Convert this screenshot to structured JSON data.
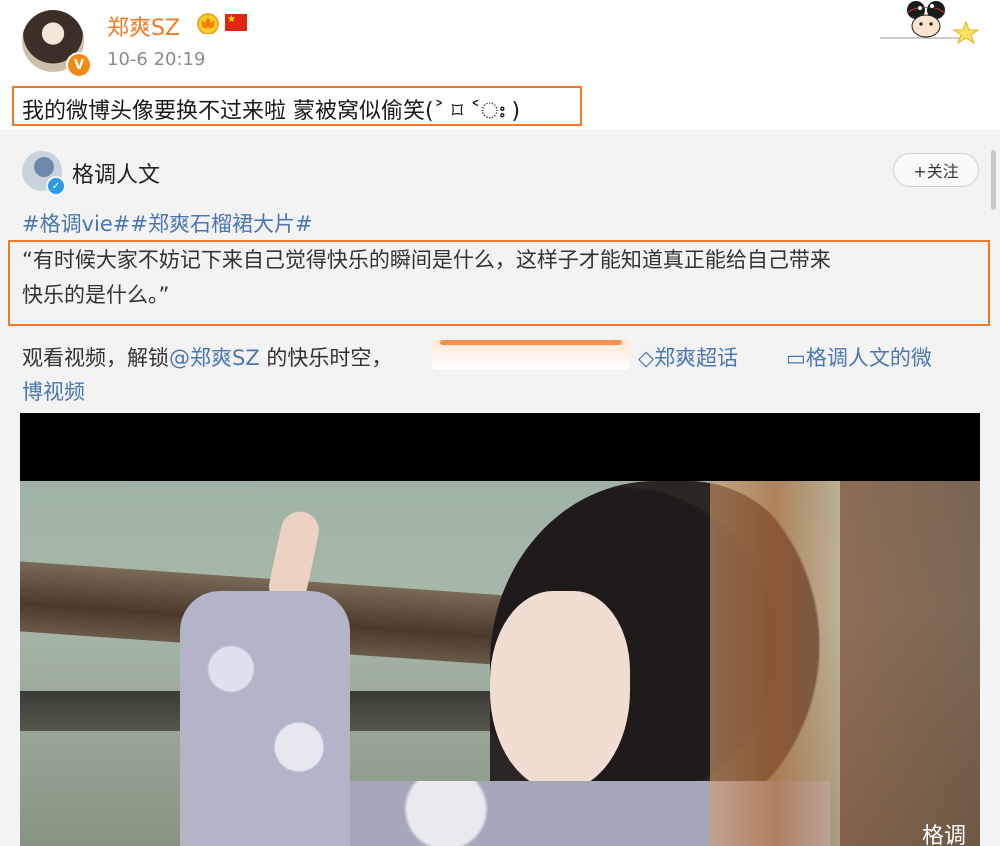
{
  "post": {
    "username": "郑爽SZ",
    "timestamp": "10-6 20:19",
    "text": "我的微博头像要换不过来啦 蒙被窝似偷笑(˃ ⌑ ˂ഃ )",
    "verified_badge": "V"
  },
  "repost": {
    "author": "格调人文",
    "follow_label": "+关注",
    "hashtags": [
      "#格调vie#",
      "#郑爽石榴裙大片#"
    ],
    "quote_line1": "“有时候大家不妨记下来自己觉得快乐的瞬间是什么，这样子才能知道真正能给自己带来",
    "quote_line2": "快乐的是什么。”",
    "watch_prefix": "观看视频，解锁",
    "mention": "@郑爽SZ",
    "watch_suffix": " 的快乐时空，",
    "super_topic": "郑爽超话",
    "video_link_line1": "格调人文的微",
    "video_link_line2": "博视频",
    "video_watermark": "格调"
  },
  "colors": {
    "username": "#f5781f",
    "link": "#4a77b4",
    "highlight_box": "#f07a2c"
  }
}
